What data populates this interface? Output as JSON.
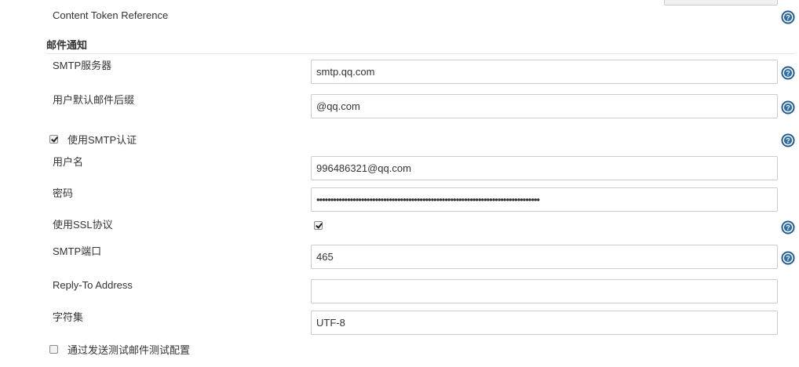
{
  "content_token": {
    "label": "Content Token Reference"
  },
  "section": {
    "title": "邮件通知"
  },
  "smtp_server": {
    "label": "SMTP服务器",
    "value": "smtp.qq.com"
  },
  "default_suffix": {
    "label": "用户默认邮件后缀",
    "value": "@qq.com"
  },
  "smtp_auth": {
    "label": "使用SMTP认证",
    "checked": true
  },
  "username": {
    "label": "用户名",
    "value": "996486321@qq.com"
  },
  "password": {
    "label": "密码",
    "value": "••••••••••••••••••••••••••••••••••••••••••••••••••••••••••••••••••••••••••••••••"
  },
  "use_ssl": {
    "label": "使用SSL协议",
    "checked": true
  },
  "smtp_port": {
    "label": "SMTP端口",
    "value": "465"
  },
  "reply_to": {
    "label": "Reply-To Address",
    "value": ""
  },
  "charset": {
    "label": "字符集",
    "value": "UTF-8"
  },
  "test_config": {
    "label": "通过发送测试邮件测试配置",
    "checked": false
  },
  "icons": {
    "help": "help-circle-icon",
    "check": "checkmark-icon"
  },
  "colors": {
    "help_icon": "#2e6ea8",
    "field_border": "#cccccc",
    "divider": "#e4e4e4"
  }
}
